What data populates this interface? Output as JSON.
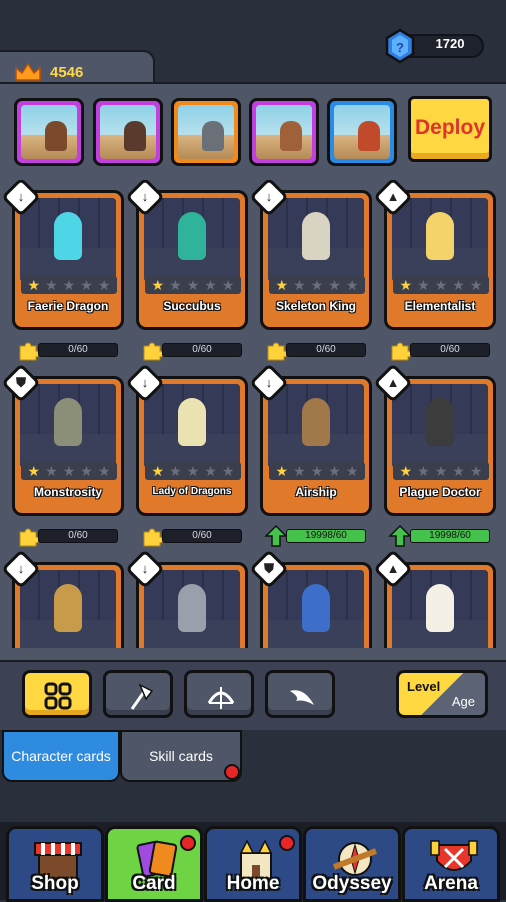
{
  "currency": {
    "gems": "1720",
    "crowns": "4546",
    "gem_icon": "blue-gem-icon",
    "crown_icon": "crown-icon"
  },
  "team": {
    "slots": [
      {
        "color": "#c23fe0"
      },
      {
        "color": "#c23fe0"
      },
      {
        "color": "#f08a1e"
      },
      {
        "color": "#c23fe0"
      },
      {
        "color": "#2a8be6"
      }
    ],
    "deploy_label": "Deploy"
  },
  "cards": [
    {
      "name": "Faerie Dragon",
      "stars": 1,
      "type": "sword",
      "progress": "0/60",
      "fill": 0,
      "art": "#4fd6e6"
    },
    {
      "name": "Succubus",
      "stars": 1,
      "type": "sword",
      "progress": "0/60",
      "fill": 0,
      "art": "#2fb39a"
    },
    {
      "name": "Skeleton King",
      "stars": 1,
      "type": "sword",
      "progress": "0/60",
      "fill": 0,
      "art": "#d9d3c2"
    },
    {
      "name": "Elementalist",
      "stars": 1,
      "type": "mage",
      "progress": "0/60",
      "fill": 0,
      "art": "#f3d36a"
    },
    {
      "name": "Monstrosity",
      "stars": 1,
      "type": "shield",
      "progress": "0/60",
      "fill": 0,
      "art": "#8b8f78"
    },
    {
      "name": "Lady of Dragons",
      "stars": 1,
      "type": "sword",
      "progress": "0/60",
      "fill": 0,
      "art": "#eae2b0"
    },
    {
      "name": "Airship",
      "stars": 1,
      "type": "sword",
      "progress": "19998/60",
      "fill": 1,
      "art": "#a0784a"
    },
    {
      "name": "Plague Doctor",
      "stars": 1,
      "type": "mage",
      "progress": "19998/60",
      "fill": 1,
      "art": "#3c3c3c"
    },
    {
      "name": "",
      "stars": 0,
      "type": "sword",
      "progress": "",
      "fill": 0,
      "art": "#c79b4a"
    },
    {
      "name": "",
      "stars": 0,
      "type": "sword",
      "progress": "",
      "fill": 0,
      "art": "#9aa0ab"
    },
    {
      "name": "",
      "stars": 0,
      "type": "shield",
      "progress": "",
      "fill": 0,
      "art": "#3d6ec9"
    },
    {
      "name": "",
      "stars": 0,
      "type": "mage",
      "progress": "",
      "fill": 0,
      "art": "#f4f0e6"
    }
  ],
  "filters": {
    "level_label": "Level",
    "age_label": "Age"
  },
  "tabs": {
    "character": "Character cards",
    "skill": "Skill cards"
  },
  "nav": [
    {
      "label": "Shop",
      "icon": "shop-stall-icon",
      "active": false,
      "dot": false
    },
    {
      "label": "Card",
      "icon": "cards-icon",
      "active": true,
      "dot": true
    },
    {
      "label": "Home",
      "icon": "castle-icon",
      "active": false,
      "dot": true
    },
    {
      "label": "Odyssey",
      "icon": "compass-icon",
      "active": false,
      "dot": false
    },
    {
      "label": "Arena",
      "icon": "crossed-swords-icon",
      "active": false,
      "dot": false
    }
  ]
}
